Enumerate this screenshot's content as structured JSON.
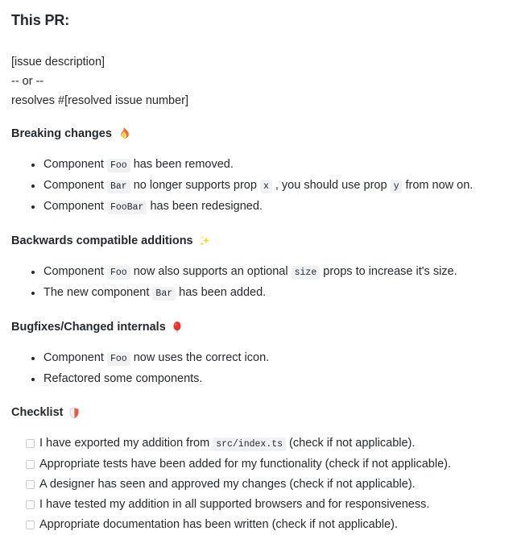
{
  "document": {
    "title": "This PR:",
    "intro": {
      "lines": [
        "[issue description]",
        "-- or --",
        "resolves #[resolved issue number]"
      ]
    },
    "sections": [
      {
        "id": "breaking-changes",
        "heading": "Breaking changes",
        "emoji": "fire-emoji",
        "emoji_char": "🔥",
        "items": [
          {
            "parts": [
              {
                "type": "text",
                "value": "Component "
              },
              {
                "type": "code",
                "value": "Foo"
              },
              {
                "type": "text",
                "value": " has been removed."
              }
            ]
          },
          {
            "parts": [
              {
                "type": "text",
                "value": "Component "
              },
              {
                "type": "code",
                "value": "Bar"
              },
              {
                "type": "text",
                "value": " no longer supports prop "
              },
              {
                "type": "code",
                "value": "x"
              },
              {
                "type": "text",
                "value": " , you should use prop "
              },
              {
                "type": "code",
                "value": "y"
              },
              {
                "type": "text",
                "value": " from now on."
              }
            ]
          },
          {
            "parts": [
              {
                "type": "text",
                "value": "Component "
              },
              {
                "type": "code",
                "value": "FooBar"
              },
              {
                "type": "text",
                "value": " has been redesigned."
              }
            ]
          }
        ]
      },
      {
        "id": "backwards-compatible-additions",
        "heading": "Backwards compatible additions",
        "emoji": "sparkles-emoji",
        "emoji_char": "✨",
        "items": [
          {
            "parts": [
              {
                "type": "text",
                "value": "Component "
              },
              {
                "type": "code",
                "value": "Foo"
              },
              {
                "type": "text",
                "value": " now also supports an optional "
              },
              {
                "type": "code",
                "value": "size"
              },
              {
                "type": "text",
                "value": " props to increase it's size."
              }
            ]
          },
          {
            "parts": [
              {
                "type": "text",
                "value": "The new component "
              },
              {
                "type": "code",
                "value": "Bar"
              },
              {
                "type": "text",
                "value": " has been added."
              }
            ]
          }
        ]
      },
      {
        "id": "bugfixes-changed-internals",
        "heading": "Bugfixes/Changed internals",
        "emoji": "balloon-emoji",
        "emoji_char": "🎈",
        "items": [
          {
            "parts": [
              {
                "type": "text",
                "value": "Component "
              },
              {
                "type": "code",
                "value": "Foo"
              },
              {
                "type": "text",
                "value": " now uses the correct icon."
              }
            ]
          },
          {
            "parts": [
              {
                "type": "text",
                "value": "Refactored some components."
              }
            ]
          }
        ]
      }
    ],
    "checklist_section": {
      "id": "checklist",
      "heading": "Checklist",
      "emoji": "shield-emoji",
      "emoji_char": "🛡",
      "items": [
        {
          "checked": false,
          "parts": [
            {
              "type": "text",
              "value": "I have exported my addition from "
            },
            {
              "type": "code",
              "value": "src/index.ts"
            },
            {
              "type": "text",
              "value": " (check if not applicable)."
            }
          ]
        },
        {
          "checked": false,
          "parts": [
            {
              "type": "text",
              "value": "Appropriate tests have been added for my functionality (check if not applicable)."
            }
          ]
        },
        {
          "checked": false,
          "parts": [
            {
              "type": "text",
              "value": "A designer has seen and approved my changes (check if not applicable)."
            }
          ]
        },
        {
          "checked": false,
          "parts": [
            {
              "type": "text",
              "value": "I have tested my addition in all supported browsers and for responsiveness."
            }
          ]
        },
        {
          "checked": false,
          "parts": [
            {
              "type": "text",
              "value": "Appropriate documentation has been written (check if not applicable)."
            }
          ]
        }
      ]
    }
  },
  "colors": {
    "text": "#24292e",
    "background": "#ffffff",
    "code_background": "#eff1f3",
    "checkbox_border": "#c8ccd0"
  }
}
